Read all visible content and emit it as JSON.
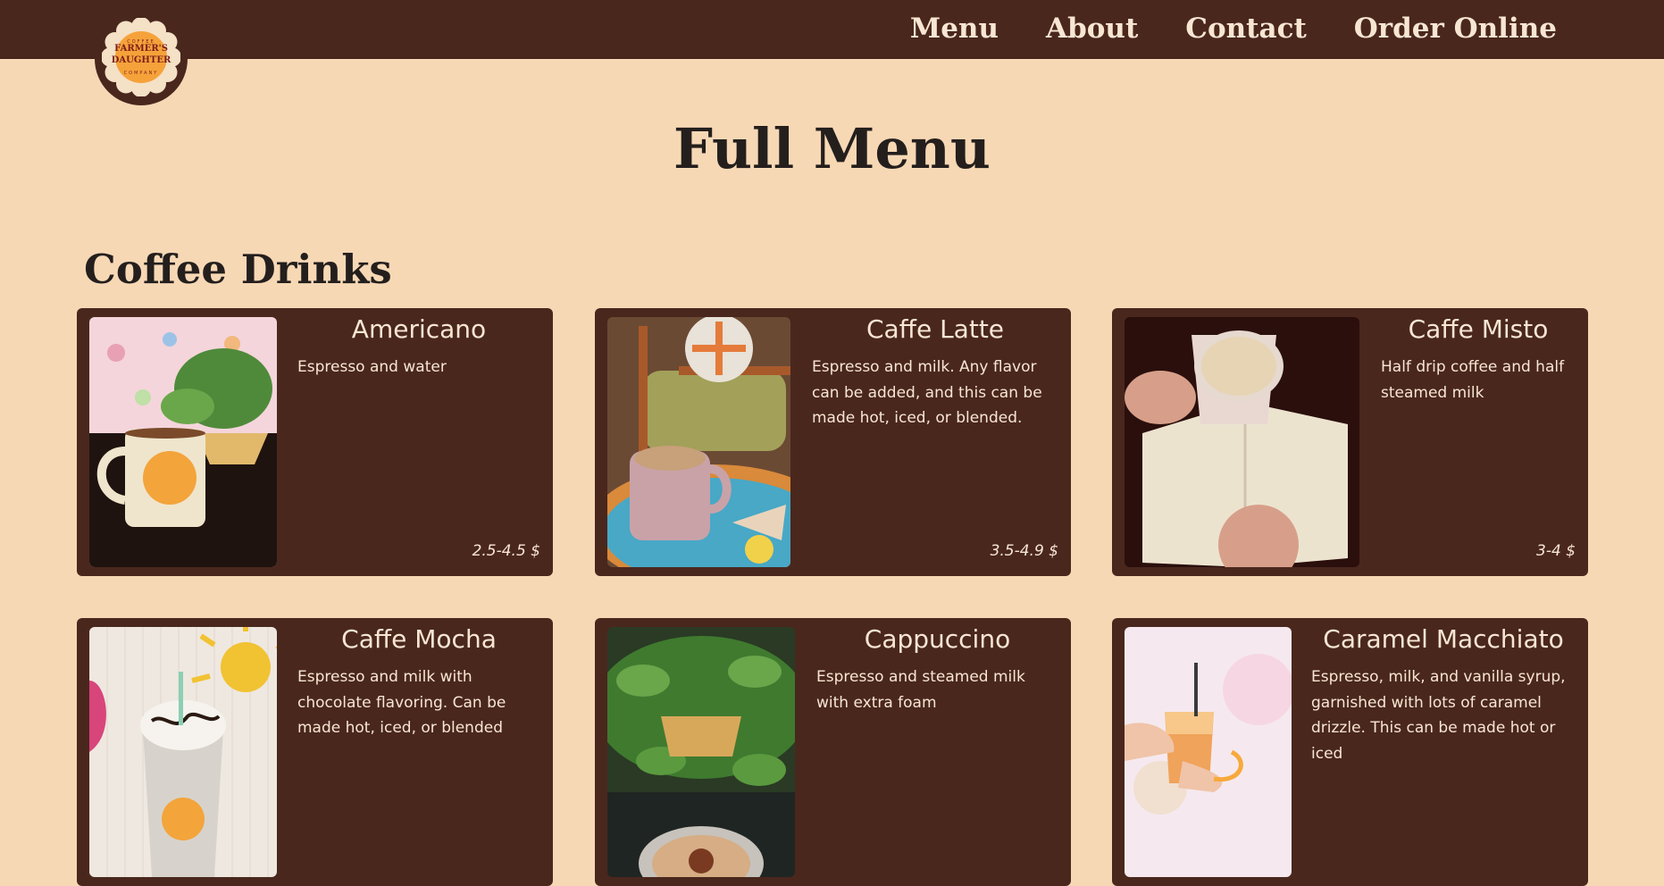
{
  "brand": {
    "logo_top": "COFFEE",
    "logo_line1": "FARMER'S",
    "logo_line2": "DAUGHTER",
    "logo_bottom": "COMPANY"
  },
  "nav": {
    "items": [
      {
        "label": "Menu"
      },
      {
        "label": "About"
      },
      {
        "label": "Contact"
      },
      {
        "label": "Order Online"
      }
    ]
  },
  "page": {
    "title": "Full Menu",
    "section_title": "Coffee Drinks"
  },
  "menu": {
    "items": [
      {
        "name": "Americano",
        "description": "Espresso and water",
        "price": "2.5-4.5 $",
        "photo": "mug-and-plant-photo"
      },
      {
        "name": "Caffe Latte",
        "description": "Espresso and milk. Any flavor can be added, and this can be made hot, iced, or blended.",
        "price": "3.5-4.9 $",
        "photo": "latte-on-table-photo"
      },
      {
        "name": "Caffe Misto",
        "description": "Half drip coffee and half steamed milk",
        "price": "3-4 $",
        "photo": "cup-over-book-photo"
      },
      {
        "name": "Caffe Mocha",
        "description": "Espresso and milk with chocolate flavoring. Can be made hot, iced, or blended",
        "price": "",
        "photo": "blended-mocha-photo"
      },
      {
        "name": "Cappuccino",
        "description": "Espresso and steamed milk with extra foam",
        "price": "",
        "photo": "plant-and-cappuccino-photo"
      },
      {
        "name": "Caramel Macchiato",
        "description": "Espresso, milk, and vanilla syrup, garnished with lots of caramel drizzle. This can be made hot or iced",
        "price": "",
        "photo": "iced-macchiato-photo"
      }
    ]
  }
}
